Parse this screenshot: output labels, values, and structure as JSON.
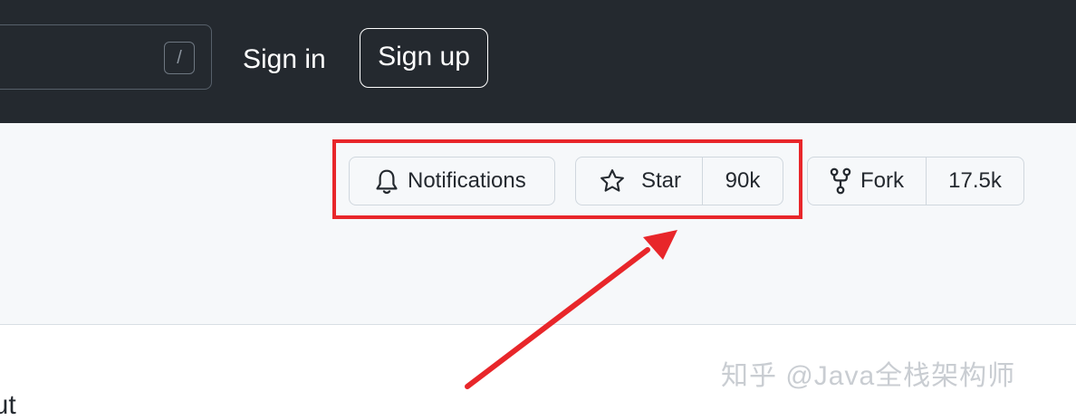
{
  "header": {
    "search_shortcut": "/",
    "sign_in": "Sign in",
    "sign_up": "Sign up"
  },
  "repo_actions": {
    "notifications_label": "Notifications",
    "star_label": "Star",
    "star_count": "90k",
    "fork_label": "Fork",
    "fork_count": "17.5k"
  },
  "content": {
    "about_heading": "out"
  },
  "watermark": {
    "text": "知乎 @Java全栈架构师"
  },
  "icons": {
    "notifications": "bell-icon",
    "star": "star-icon",
    "fork": "repo-forked-icon",
    "annotation": "red-arrow-icon"
  },
  "colors": {
    "header_bg": "#24292f",
    "page_bg": "#f6f8fa",
    "highlight": "#e8262a",
    "text": "#24292f",
    "border": "#d0d7de"
  }
}
